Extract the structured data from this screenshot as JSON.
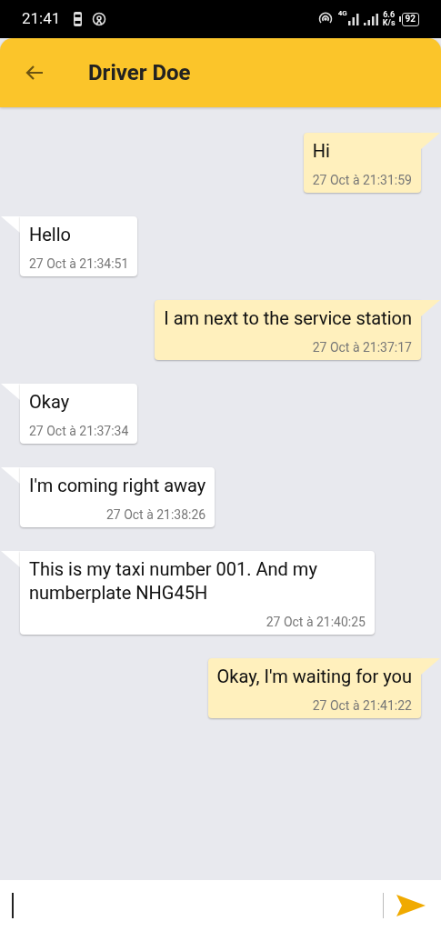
{
  "status_bar": {
    "time": "21:41",
    "network": "4G",
    "speed_value": "6.6",
    "speed_unit": "K/s",
    "battery": "92"
  },
  "header": {
    "title": "Driver Doe"
  },
  "messages": [
    {
      "kind": "sent",
      "text": "Hi",
      "time": "27 Oct à 21:31:59"
    },
    {
      "kind": "received",
      "text": "Hello",
      "time": "27 Oct à 21:34:51"
    },
    {
      "kind": "sent",
      "text": "I am next to the service station",
      "time": "27 Oct à 21:37:17"
    },
    {
      "kind": "received",
      "text": "Okay",
      "time": "27 Oct à 21:37:34"
    },
    {
      "kind": "received",
      "text": "I'm coming right away",
      "time": "27 Oct à 21:38:26"
    },
    {
      "kind": "received",
      "text": "This is my taxi number 001. And my numberplate NHG45H",
      "time": "27 Oct à 21:40:25"
    },
    {
      "kind": "sent",
      "text": "Okay, I'm waiting for you",
      "time": "27 Oct à 21:41:22"
    }
  ]
}
